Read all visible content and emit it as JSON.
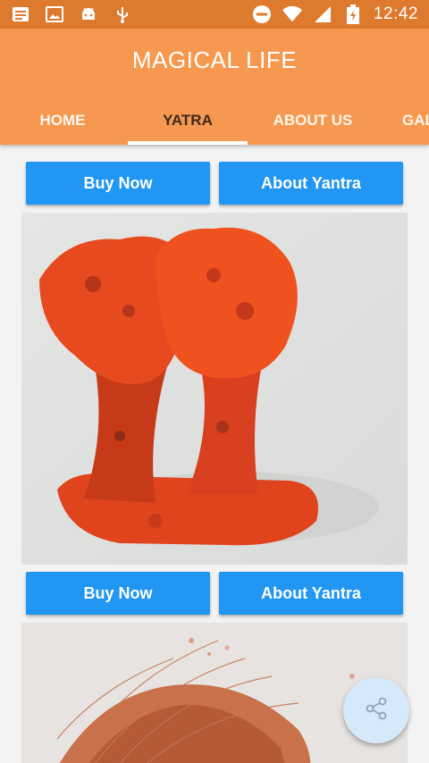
{
  "status_bar": {
    "time": "12:42",
    "icons": [
      "notification-icon",
      "image-icon",
      "android-icon",
      "usb-icon",
      "do-not-disturb-icon",
      "wifi-icon",
      "signal-icon",
      "battery-icon"
    ]
  },
  "app_bar": {
    "title": "MAGICAL LIFE",
    "tabs": [
      {
        "label": "HOME",
        "active": false
      },
      {
        "label": "YATRA",
        "active": true
      },
      {
        "label": "ABOUT US",
        "active": false
      },
      {
        "label": "GAL",
        "active": false
      }
    ]
  },
  "cards": [
    {
      "buy_label": "Buy Now",
      "about_label": "About Yantra"
    },
    {
      "buy_label": "Buy Now",
      "about_label": "About Yantra"
    }
  ],
  "fab": {
    "icon": "share-icon"
  },
  "colors": {
    "status_bar": "#de7a2e",
    "app_bar": "#f6984f",
    "button": "#2196f3",
    "fab": "#d6e9fb"
  }
}
